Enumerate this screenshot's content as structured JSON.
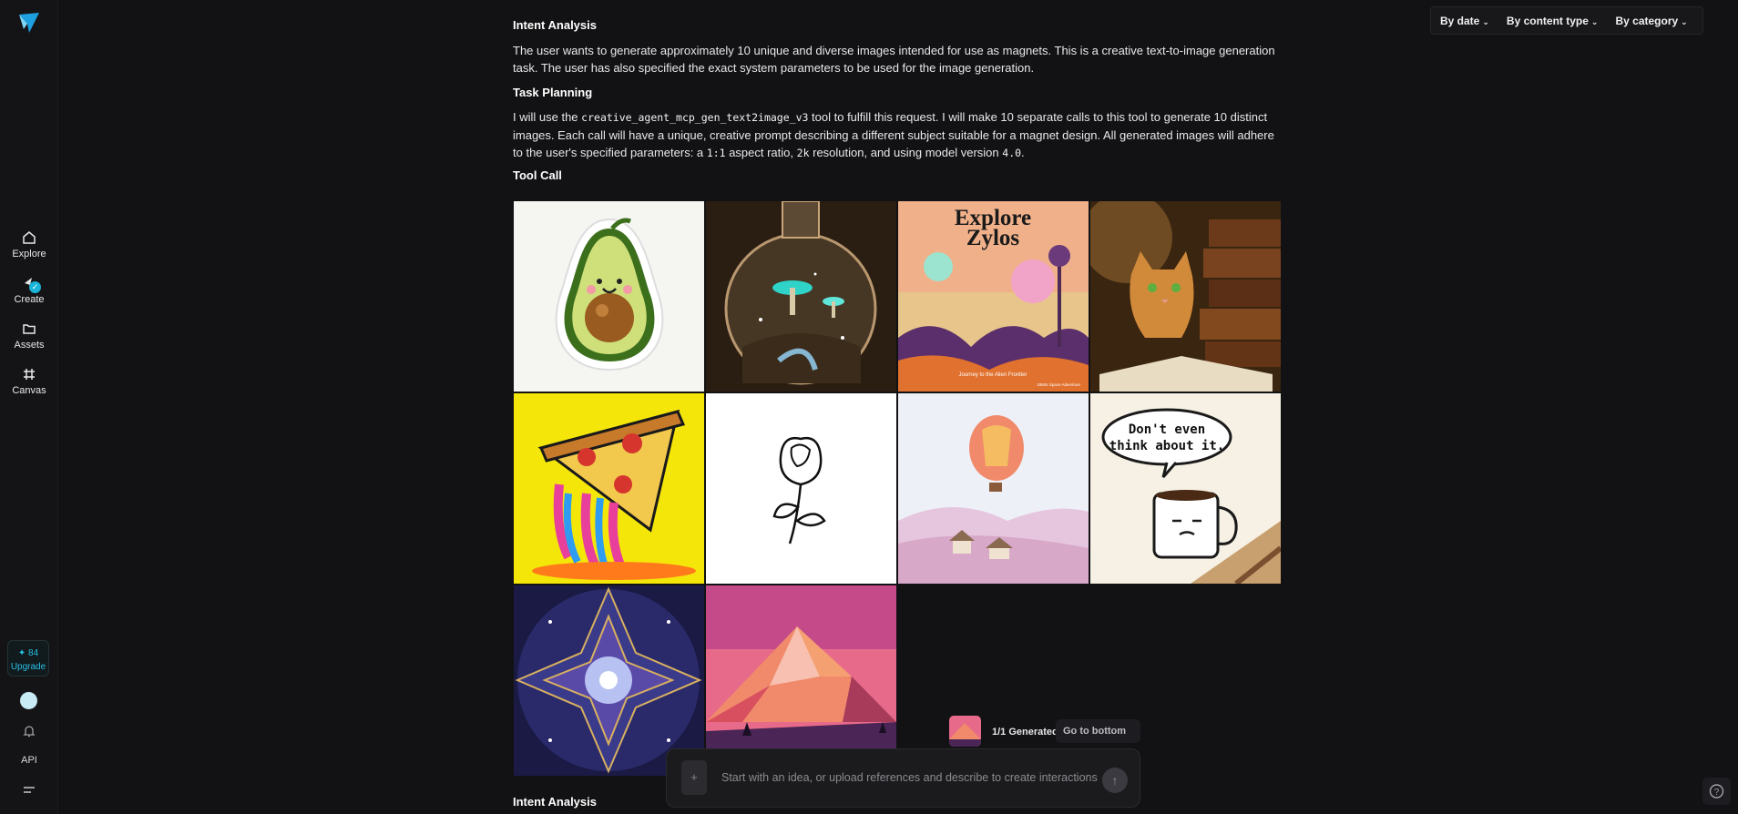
{
  "sidebar": {
    "items": [
      {
        "label": "Explore"
      },
      {
        "label": "Create"
      },
      {
        "label": "Assets"
      },
      {
        "label": "Canvas"
      }
    ],
    "credits": "✦ 84",
    "upgrade_label": "Upgrade",
    "api_label": "API"
  },
  "filters": {
    "by_date": "By date",
    "by_content_type": "By content type",
    "by_category": "By category"
  },
  "message": {
    "intent_heading": "Intent Analysis",
    "intent_text": "The user wants to generate approximately 10 unique and diverse images intended for use as magnets. This is a creative text-to-image generation task. The user has also specified the exact system parameters to be used for the image generation.",
    "planning_heading": "Task Planning",
    "planning_prefix": "I will use the",
    "tool_name": "creative_agent_mcp_gen_text2image_v3",
    "planning_middle": "tool to fulfill this request. I will make 10 separate calls to this tool to generate 10 distinct images. Each call will have a unique, creative prompt describing a different subject suitable for a magnet design. All generated images will adhere to the user's specified parameters: a",
    "aspect_ratio": "1:1",
    "planning_after_ratio": "aspect ratio,",
    "resolution": "2k",
    "planning_after_res": "resolution, and using model version",
    "model_version": "4.0",
    "planning_end": ".",
    "tool_call_heading": "Tool Call",
    "next_intent_heading": "Intent Analysis"
  },
  "images": {
    "poster_title_1": "Explore",
    "poster_title_2": "Zylos",
    "poster_caption": "Journey to the Alien Frontier",
    "poster_corner": "1950s Space Adventure",
    "mug_bubble_1": "Don't even",
    "mug_bubble_2": "think about it."
  },
  "generation": {
    "status": "1/1 Generated",
    "go_to_bottom": "Go to bottom"
  },
  "composer": {
    "placeholder": "Start with an idea, or upload references and describe to create interactions",
    "add_icon": "+",
    "send_icon": "↑"
  },
  "colors": {
    "accent": "#19b4d8",
    "background": "#121214"
  }
}
